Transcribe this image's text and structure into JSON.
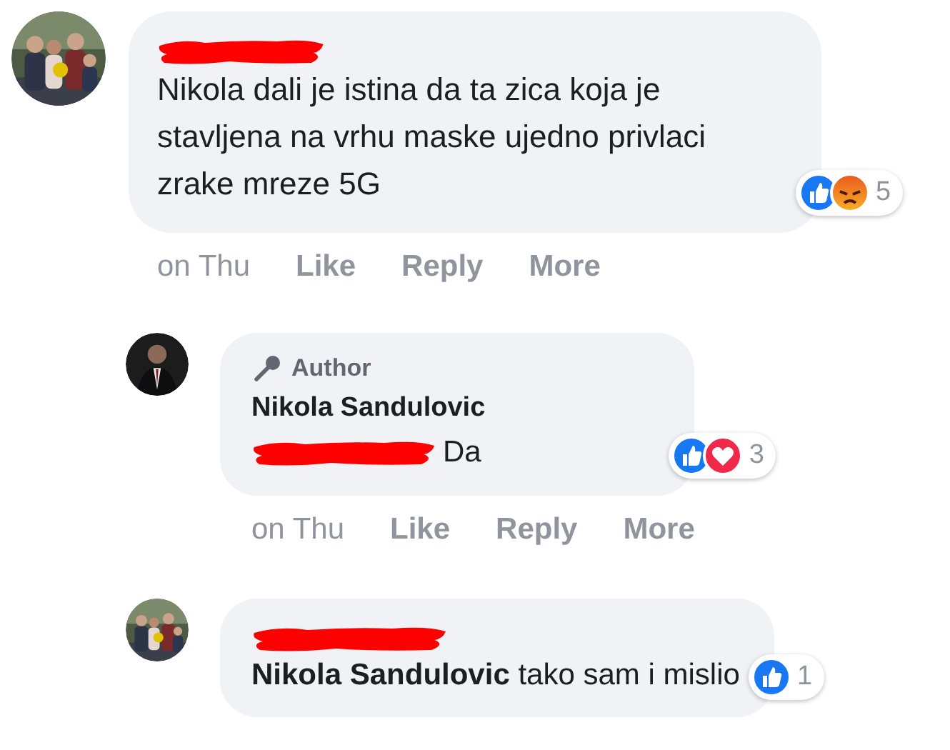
{
  "comments": [
    {
      "author_redacted": true,
      "text": "Nikola dali je istina da ta zica koja je stavljena na vrhu maske ujedno privlaci zrake mreze 5G",
      "reactions": [
        {
          "kind": "like"
        },
        {
          "kind": "angry"
        }
      ],
      "reaction_count": "5",
      "actions": {
        "time": "on Thu",
        "links": [
          "Like",
          "Reply",
          "More"
        ]
      },
      "children": [
        {
          "badge": "Author",
          "author": "Nikola Sandulovic",
          "mention_redacted": true,
          "text": "Da",
          "reactions": [
            {
              "kind": "like"
            },
            {
              "kind": "love"
            }
          ],
          "reaction_count": "3",
          "actions": {
            "time": "on Thu",
            "links": [
              "Like",
              "Reply",
              "More"
            ]
          }
        },
        {
          "author_redacted": true,
          "text": "**Nikola Sandulovic** tako sam i mislio",
          "reactions": [
            {
              "kind": "like"
            }
          ],
          "reaction_count": "1"
        }
      ]
    }
  ]
}
